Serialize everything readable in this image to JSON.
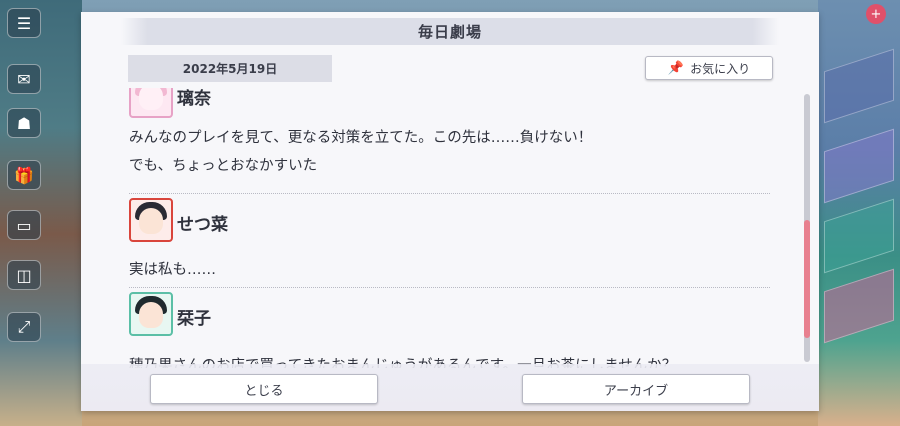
{
  "dialog": {
    "title": "毎日劇場",
    "date": "2022年5月19日",
    "favorite_label": "お気に入り",
    "close_label": "とじる",
    "archive_label": "アーカイブ"
  },
  "entries": [
    {
      "name": "璃奈",
      "lines": [
        "みんなのプレイを見て、更なる対策を立てた。この先は……負けない！",
        "でも、ちょっとおなかすいた"
      ],
      "frame_color": "#e7a2c6"
    },
    {
      "name": "せつ菜",
      "lines": [
        "実は私も……"
      ],
      "frame_color": "#d9453c"
    },
    {
      "name": "栞子",
      "lines": [
        "穂乃果さんのお店で買ってきたおまんじゅうがあるんです。一旦お茶にしませんか？"
      ],
      "frame_color": "#5bbfa6"
    }
  ],
  "icons": {
    "menu": "hamburger-icon",
    "pin": "pushpin-icon",
    "badge": "+"
  },
  "colors": {
    "scroll_thumb": "#e8808f",
    "title_bar": "#dcdee8"
  }
}
